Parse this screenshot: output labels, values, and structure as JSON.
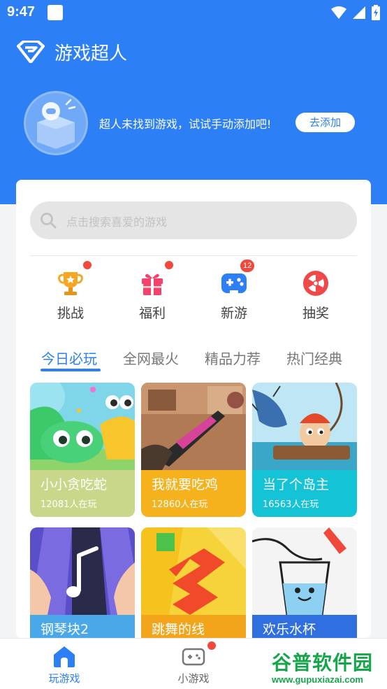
{
  "status_bar": {
    "time": "9:47",
    "icons": [
      "wifi-icon",
      "signal-icon",
      "battery-icon"
    ]
  },
  "header": {
    "title": "游戏超人",
    "logo_icon": "superman-logo-icon"
  },
  "empty_state": {
    "message": "超人未找到游戏，试试手动添加吧!",
    "add_button": "去添加"
  },
  "search": {
    "placeholder": "点击搜索喜爱的游戏"
  },
  "quick_actions": [
    {
      "label": "挑战",
      "icon": "trophy-icon",
      "badge_dot": true
    },
    {
      "label": "福利",
      "icon": "gift-icon",
      "badge_dot": true
    },
    {
      "label": "新游",
      "icon": "gamepad-icon",
      "badge_count": "12"
    },
    {
      "label": "抽奖",
      "icon": "lottery-wheel-icon",
      "badge_dot": false
    }
  ],
  "tabs": [
    {
      "label": "今日必玩",
      "active": true
    },
    {
      "label": "全网最火",
      "active": false
    },
    {
      "label": "精品力荐",
      "active": false
    },
    {
      "label": "热门经典",
      "active": false
    }
  ],
  "games": [
    {
      "name": "小小贪吃蛇",
      "players": "12081人在玩"
    },
    {
      "name": "我就要吃鸡",
      "players": "12860人在玩"
    },
    {
      "name": "当了个岛主",
      "players": "16563人在玩"
    },
    {
      "name": "钢琴块2",
      "players": ""
    },
    {
      "name": "跳舞的线",
      "players": ""
    },
    {
      "name": "欢乐水杯",
      "players": ""
    }
  ],
  "bottom_nav": [
    {
      "label": "玩游戏",
      "icon": "home-icon",
      "active": true
    },
    {
      "label": "小游戏",
      "icon": "gamepad-icon",
      "active": false,
      "badge_dot": true
    }
  ],
  "watermark": {
    "title": "谷普软件园",
    "url": "www.gupuxiazai.com"
  },
  "colors": {
    "primary": "#2d7ff5",
    "badge": "#f0483a",
    "watermark": "#16a64a"
  }
}
